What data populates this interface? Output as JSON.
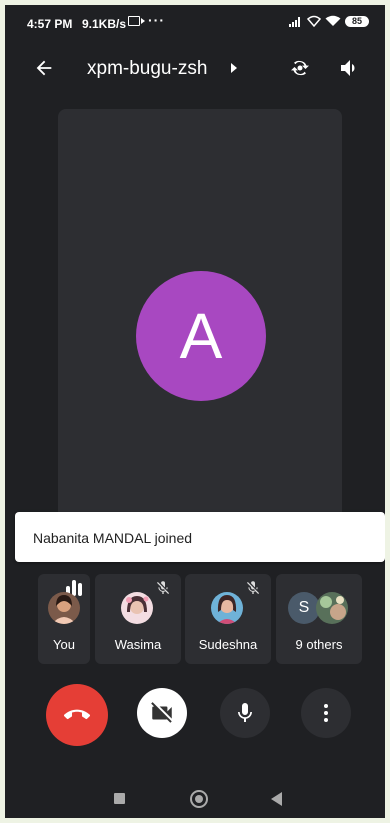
{
  "status_bar": {
    "time": "4:57 PM",
    "speed": "9.1KB/s",
    "dots": "···",
    "battery": "85"
  },
  "header": {
    "meeting_code": "xpm-bugu-zsh"
  },
  "main_tile": {
    "avatar_letter": "A",
    "avatar_color": "#a848c1"
  },
  "toast": {
    "message": "Nabanita MANDAL joined"
  },
  "participants": [
    {
      "name": "You",
      "speaking": true
    },
    {
      "name": "Wasima",
      "muted": true
    },
    {
      "name": "Sudeshna",
      "muted": true
    },
    {
      "name": "9 others",
      "initial": "S"
    }
  ],
  "colors": {
    "end_call": "#e53e36",
    "background": "#1f2023",
    "tile": "#2d2e32"
  }
}
